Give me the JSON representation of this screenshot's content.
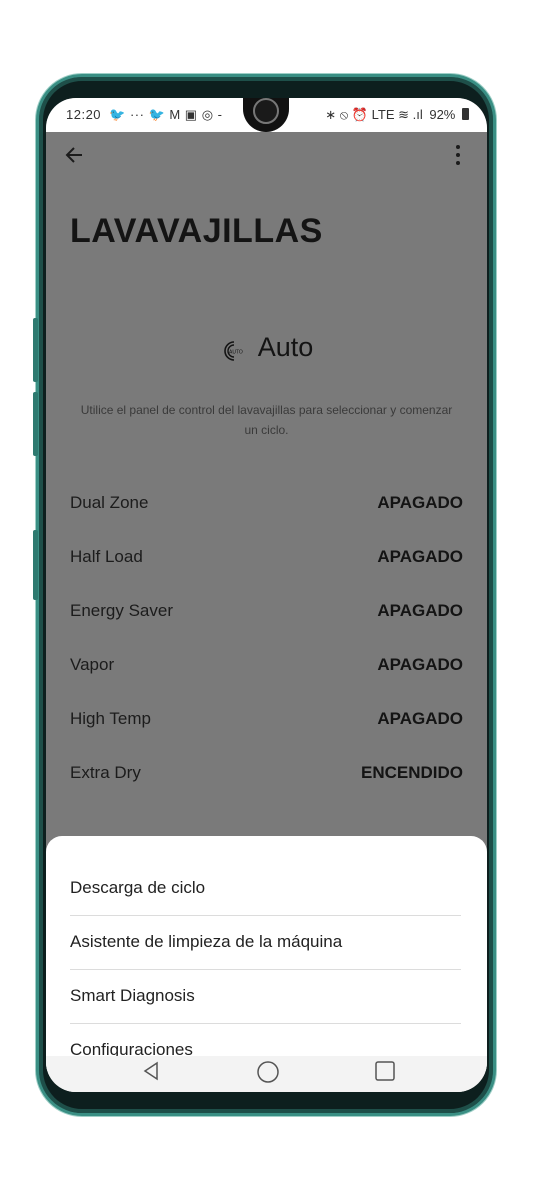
{
  "status_bar": {
    "time": "12:20",
    "left_icons": "🐦 ··· 🐦 M ▣ ◎ -",
    "right_icons": "∗ ⦸ ⏰ LTE ≋ .ıl",
    "battery": "92%"
  },
  "app": {
    "title": "LAVAVAJILLAS",
    "mode_label": "Auto",
    "mode_icon_text": "AUTO",
    "hint": "Utilice el panel de control del lavavajillas para seleccionar y comenzar un ciclo.",
    "options": [
      {
        "label": "Dual Zone",
        "value": "APAGADO"
      },
      {
        "label": "Half Load",
        "value": "APAGADO"
      },
      {
        "label": "Energy Saver",
        "value": "APAGADO"
      },
      {
        "label": "Vapor",
        "value": "APAGADO"
      },
      {
        "label": "High Temp",
        "value": "APAGADO"
      },
      {
        "label": "Extra Dry",
        "value": "ENCENDIDO"
      }
    ]
  },
  "menu": {
    "items": [
      {
        "label": "Descarga de ciclo"
      },
      {
        "label": "Asistente de limpieza de la máquina"
      },
      {
        "label": "Smart Diagnosis"
      },
      {
        "label": "Configuraciones"
      }
    ]
  },
  "colors": {
    "overlay_bg": "#7a7a7a",
    "sheet_bg": "#ffffff",
    "frame_accent": "#3a8f84"
  }
}
